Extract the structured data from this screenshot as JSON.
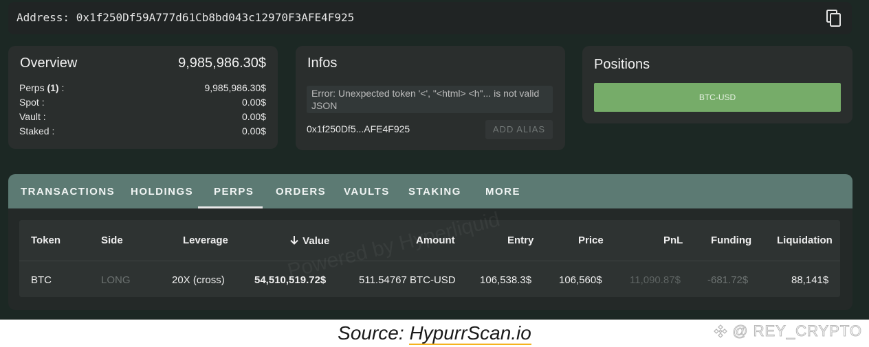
{
  "address_bar": {
    "label": "Address:",
    "value": "0x1f250Df59A777d61Cb8bd043c12970F3AFE4F925",
    "copy_icon": "copy-icon"
  },
  "overview": {
    "title": "Overview",
    "total": "9,985,986.30$",
    "rows": [
      {
        "label": "Perps",
        "count": "(1)",
        "suffix": ":",
        "value": "9,985,986.30$"
      },
      {
        "label": "Spot :",
        "value": "0.00$"
      },
      {
        "label": "Vault :",
        "value": "0.00$"
      },
      {
        "label": "Staked :",
        "value": "0.00$"
      }
    ]
  },
  "infos": {
    "title": "Infos",
    "error": "Error: Unexpected token '<', \"<html> <h\"... is not valid JSON",
    "short_address": "0x1f250Df5...AFE4F925",
    "add_alias_label": "ADD ALIAS"
  },
  "positions": {
    "title": "Positions",
    "items": [
      "BTC-USD"
    ],
    "item_color": "#76ac69"
  },
  "tabs": {
    "items": [
      "TRANSACTIONS",
      "HOLDINGS",
      "PERPS",
      "ORDERS",
      "VAULTS",
      "STAKING",
      "MORE"
    ],
    "active": "PERPS"
  },
  "table": {
    "headers": [
      "Token",
      "Side",
      "Leverage",
      "Value",
      "Amount",
      "Entry",
      "Price",
      "PnL",
      "Funding",
      "Liquidation"
    ],
    "sort_icon": "arrow-down-icon",
    "rows": [
      {
        "token": "BTC",
        "side": "LONG",
        "leverage": "20X (cross)",
        "value": "54,510,519.72$",
        "amount": "511.54767 BTC-USD",
        "entry": "106,538.3$",
        "price": "106,560$",
        "pnl": "11,090.87$",
        "funding": "-681.72$",
        "liquidation": "88,141$"
      }
    ]
  },
  "watermark": "Powered by Hyperliquid",
  "source": {
    "prefix": "Source: ",
    "link": "HypurrScan.io"
  },
  "brand": {
    "text": "@ REY_CRYPTO",
    "icon": "binance-logo-icon"
  },
  "colors": {
    "background": "#1c2824",
    "card": "#2a2e2d",
    "tab_bar": "#5c7a73",
    "accent_green": "#76ac69",
    "underline_gold": "#f5b21e"
  }
}
